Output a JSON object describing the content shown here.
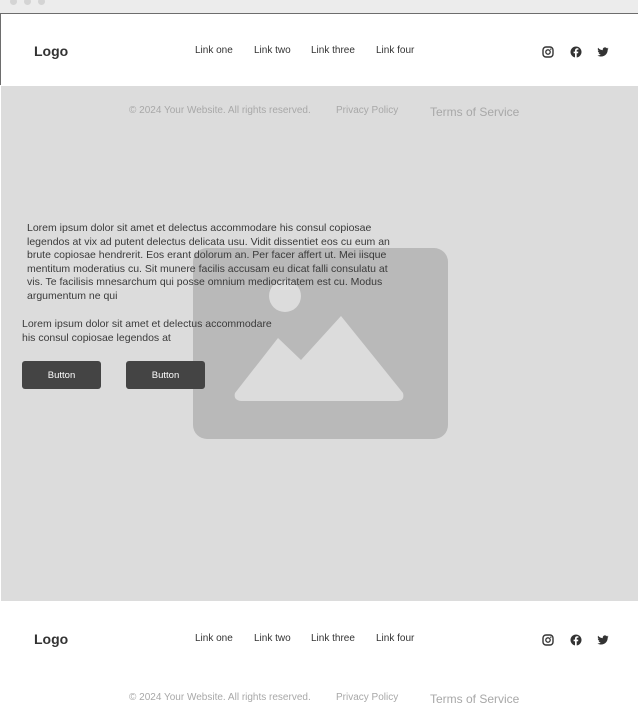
{
  "header": {
    "logo": "Logo",
    "nav": [
      "Link one",
      "Link two",
      "Link three",
      "Link four"
    ],
    "social": [
      "instagram-icon",
      "facebook-icon",
      "twitter-icon"
    ]
  },
  "banner": {
    "copyright": "© 2024 Your Website. All rights reserved.",
    "privacy": "Privacy Policy",
    "terms": "Terms of Service"
  },
  "hero": {
    "paragraph1": "Lorem ipsum dolor sit amet et delectus accommodare his consul copiosae legendos at vix ad putent delectus delicata usu. Vidit dissentiet eos cu eum an brute copiosae hendrerit. Eos erant dolorum an. Per facer affert ut. Mei iisque mentitum moderatius cu. Sit munere facilis accusam eu dicat falli consulatu at vis. Te facilisis mnesarchum qui posse omnium mediocritatem est cu. Modus argumentum ne qui",
    "paragraph2": "Lorem ipsum dolor sit amet et delectus accommodare his consul copiosae legendos at",
    "button1": "Button",
    "button2": "Button",
    "image_icon": "image-placeholder-icon"
  },
  "footer": {
    "logo": "Logo",
    "nav": [
      "Link one",
      "Link two",
      "Link three",
      "Link four"
    ],
    "copyright": "© 2024 Your Website. All rights reserved.",
    "privacy": "Privacy Policy",
    "terms": "Terms of Service"
  },
  "colors": {
    "background": "#dcdcdc",
    "placeholder": "#b9b9b9",
    "button": "#444444",
    "muted_text": "#a8a8a8"
  }
}
